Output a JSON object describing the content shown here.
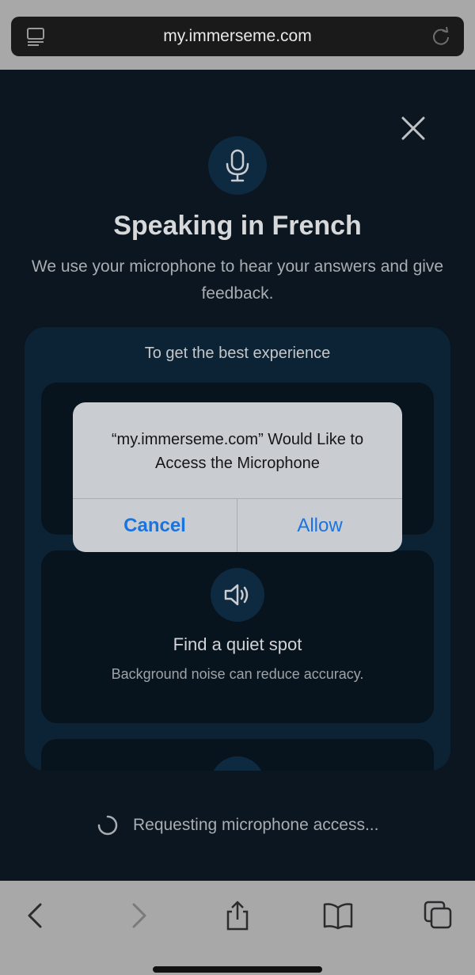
{
  "browser": {
    "url": "my.immerseme.com",
    "icons": {
      "reader": "reader-icon",
      "reload": "reload-icon"
    }
  },
  "page": {
    "title": "Speaking in French",
    "subtitle": "We use your microphone to hear your answers and give feedback.",
    "panel_heading": "To get the best experience",
    "cards": [
      {
        "icon": "mic-icon",
        "title": "",
        "description": ""
      },
      {
        "icon": "speaker-icon",
        "title": "Find a quiet spot",
        "description": "Background noise can reduce accuracy."
      },
      {
        "icon": "circle-icon",
        "title": "",
        "description": ""
      }
    ],
    "status": "Requesting microphone access..."
  },
  "alert": {
    "message": "“my.immerseme.com” Would Like to Access the Microphone",
    "cancel_label": "Cancel",
    "allow_label": "Allow"
  },
  "colors": {
    "accent": "#1a74e0",
    "page_bg": "#0b1620",
    "panel_bg": "#0c2335",
    "chrome_bg": "#a8a8a9"
  }
}
